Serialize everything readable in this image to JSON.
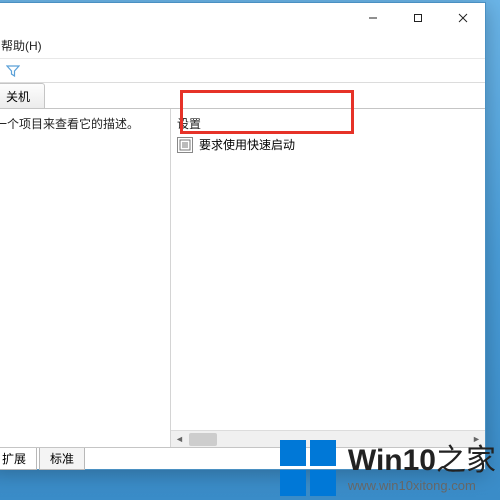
{
  "window": {
    "controls": {
      "min": "—",
      "max": "□",
      "close": "✕"
    }
  },
  "menubar": {
    "help": "帮助(H)"
  },
  "toolbar": {
    "filter_icon": "filter"
  },
  "tabs": {
    "top_active": "关机"
  },
  "left_pane": {
    "description_hint": "一个项目来查看它的描述。"
  },
  "right_pane": {
    "group_label": "设置",
    "items": [
      {
        "label": "要求使用快速启动"
      }
    ]
  },
  "bottom_tabs": {
    "extended": "扩展",
    "standard": "标准"
  },
  "watermark": {
    "brand_main": "Win10",
    "brand_suffix": "之家",
    "url": "www.win10xitong.com"
  }
}
